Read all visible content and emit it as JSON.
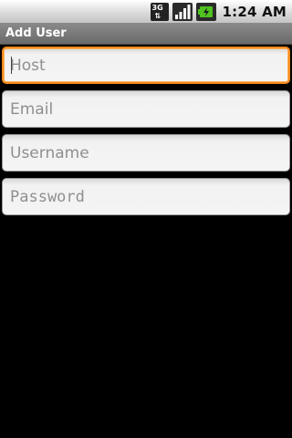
{
  "status_bar": {
    "network_label": "3G",
    "network_arrows": "⇅",
    "time": "1:24 AM",
    "icons": [
      "network-3g-icon",
      "signal-strength-icon",
      "battery-charging-icon"
    ],
    "battery_color": "#4fc21f"
  },
  "title_bar": {
    "title": "Add User"
  },
  "form": {
    "host": {
      "placeholder": "Host",
      "value": ""
    },
    "email": {
      "placeholder": "Email",
      "value": ""
    },
    "username": {
      "placeholder": "Username",
      "value": ""
    },
    "password": {
      "placeholder": "Password",
      "value": ""
    },
    "focus_color": "#f28a1e"
  }
}
